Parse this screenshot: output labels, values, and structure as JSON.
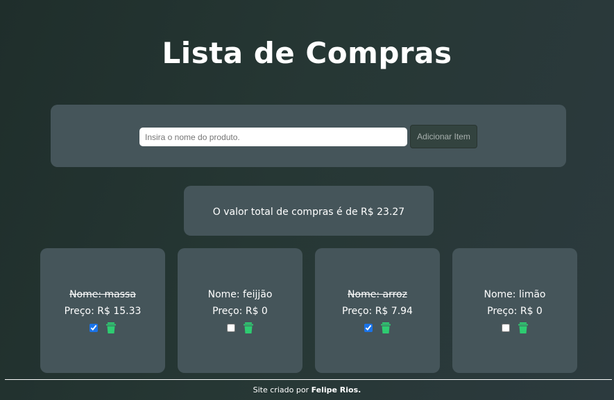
{
  "header": {
    "title": "Lista de Compras"
  },
  "form": {
    "placeholder": "Insira o nome do produto.",
    "value": "",
    "add_label": "Adicionar Item"
  },
  "total": {
    "text": "O valor total de compras é de R$ 23.27"
  },
  "items": [
    {
      "name": "Nome: massa",
      "price": "Preço: R$ 15.33",
      "checked": true
    },
    {
      "name": "Nome: feijjão",
      "price": "Preço: R$ 0",
      "checked": false
    },
    {
      "name": "Nome: arroz",
      "price": "Preço: R$ 7.94",
      "checked": true
    },
    {
      "name": "Nome: limão",
      "price": "Preço: R$ 0",
      "checked": false
    }
  ],
  "footer": {
    "prefix": "Site criado por ",
    "author": "Felipe Rios."
  },
  "colors": {
    "card_bg": "#45555a",
    "trash_icon": "#2ecc71",
    "checkbox_accent": "#1a73e8"
  },
  "icons": {
    "delete": "trash-icon"
  }
}
